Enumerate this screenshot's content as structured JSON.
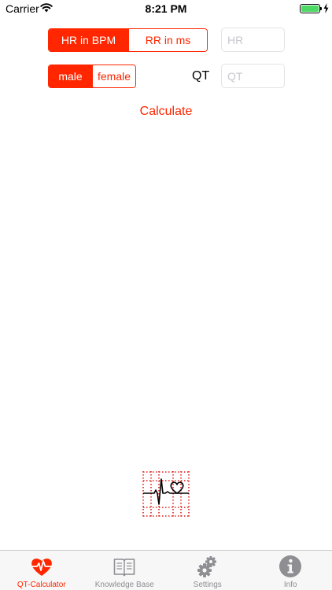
{
  "status_bar": {
    "carrier": "Carrier",
    "time": "8:21 PM",
    "battery_level": 1.0
  },
  "calculator": {
    "units": {
      "options": [
        "HR in BPM",
        "RR in ms"
      ],
      "selected_index": 0
    },
    "hr_field": {
      "value": "",
      "placeholder": "HR"
    },
    "sex": {
      "options": [
        "male",
        "female"
      ],
      "selected_index": 0
    },
    "qt_label": "QT",
    "qt_field": {
      "value": "",
      "placeholder": "QT"
    },
    "calculate_label": "Calculate"
  },
  "logo": {
    "icon": "ecg-heart-logo"
  },
  "tab_bar": {
    "tabs": [
      {
        "label": "QT-Calculator",
        "icon": "heart-pulse-icon",
        "active": true
      },
      {
        "label": "Knowledge Base",
        "icon": "book-icon",
        "active": false
      },
      {
        "label": "Settings",
        "icon": "gear-icon",
        "active": false
      },
      {
        "label": "Info",
        "icon": "info-icon",
        "active": false
      }
    ]
  },
  "colors": {
    "accent": "#ff2600",
    "inactive": "#8e8e93",
    "battery": "#4cd964",
    "tab_bar_bg": "#f7f7f7"
  }
}
